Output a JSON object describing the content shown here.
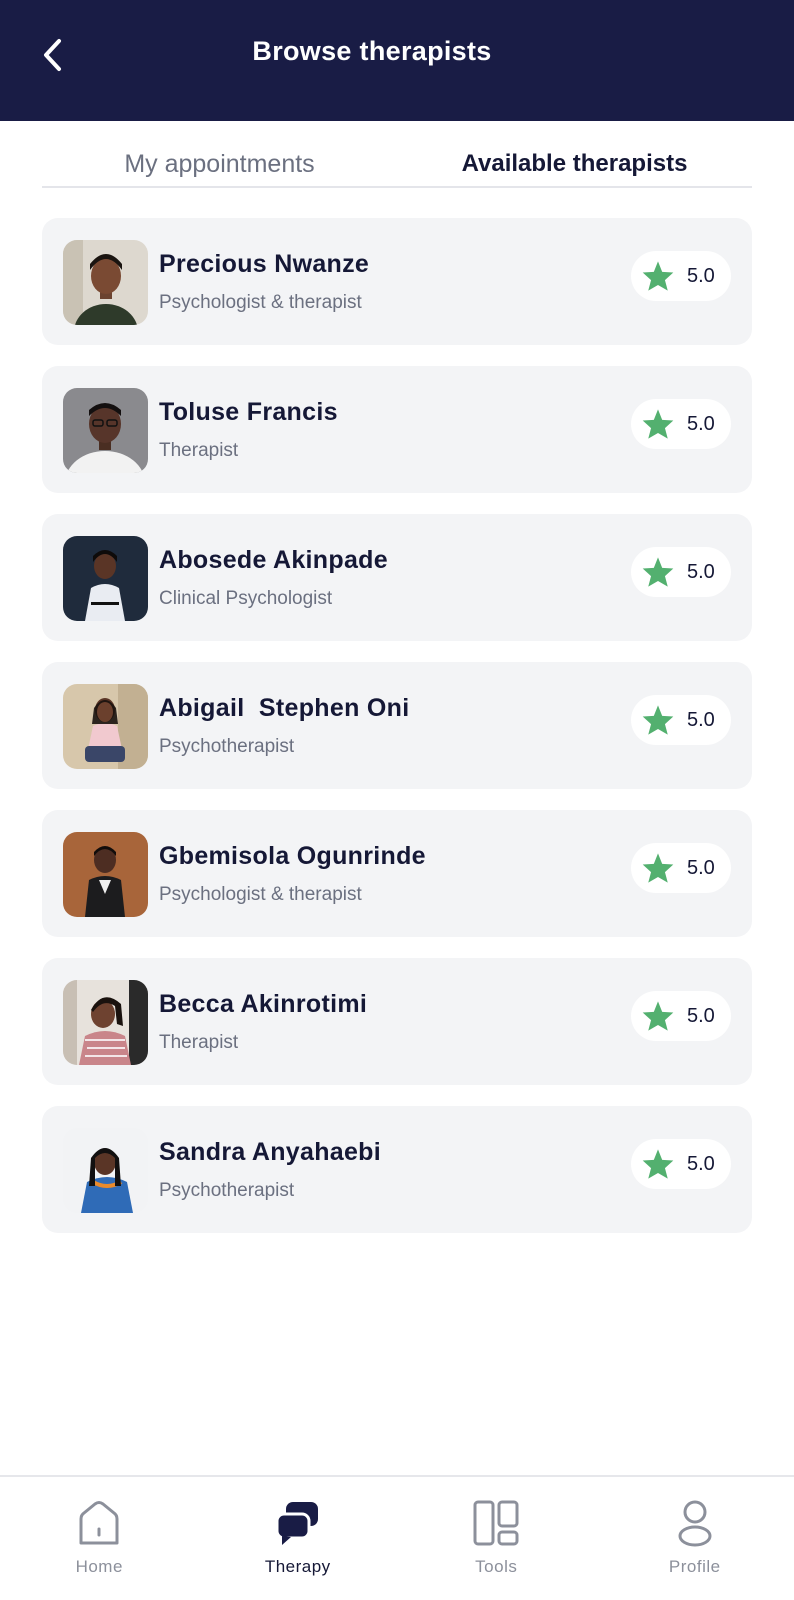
{
  "header": {
    "title": "Browse therapists",
    "background": "#191c45"
  },
  "tabs": [
    {
      "label": "My appointments",
      "active": false
    },
    {
      "label": "Available therapists",
      "active": true
    }
  ],
  "accent": {
    "star": "#53b06f"
  },
  "therapists": [
    {
      "name": "Precious Nwanze",
      "role": "Psychologist & therapist",
      "rating": "5.0"
    },
    {
      "name": "Toluse Francis",
      "role": "Therapist",
      "rating": "5.0"
    },
    {
      "name": "Abosede Akinpade",
      "role": "Clinical Psychologist",
      "rating": "5.0"
    },
    {
      "name": "Abigail  Stephen Oni",
      "role": "Psychotherapist",
      "rating": "5.0"
    },
    {
      "name": "Gbemisola Ogunrinde",
      "role": "Psychologist & therapist",
      "rating": "5.0"
    },
    {
      "name": "Becca Akinrotimi",
      "role": "Therapist",
      "rating": "5.0"
    },
    {
      "name": "Sandra Anyahaebi",
      "role": "Psychotherapist",
      "rating": "5.0"
    }
  ],
  "nav": [
    {
      "label": "Home",
      "icon": "home-icon",
      "active": false
    },
    {
      "label": "Therapy",
      "icon": "chat-bubbles-icon",
      "active": true
    },
    {
      "label": "Tools",
      "icon": "grid-icon",
      "active": false
    },
    {
      "label": "Profile",
      "icon": "person-icon",
      "active": false
    }
  ]
}
